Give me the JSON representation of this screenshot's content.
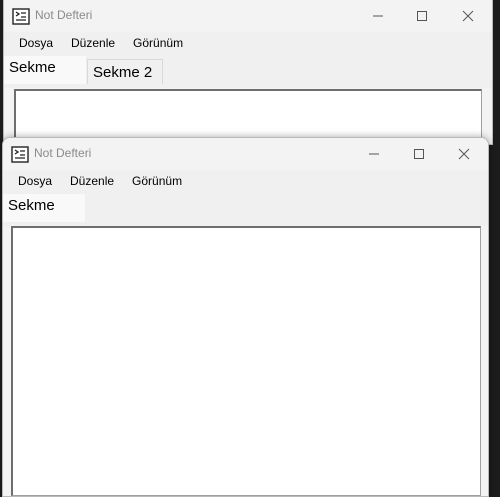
{
  "back_window": {
    "title": "Not Defteri",
    "menu": [
      "Dosya",
      "Düzenle",
      "Görünüm"
    ],
    "tabs": [
      {
        "label": "Sekme",
        "active": true
      },
      {
        "label": "Sekme 2",
        "active": false
      }
    ]
  },
  "front_window": {
    "title": "Not Defteri",
    "menu": [
      "Dosya",
      "Düzenle",
      "Görünüm"
    ],
    "tabs": [
      {
        "label": "Sekme",
        "active": true
      }
    ]
  },
  "icons": {
    "app": "notepad-app-icon",
    "minimize": "minimize-icon",
    "maximize": "maximize-icon",
    "close": "close-icon"
  }
}
